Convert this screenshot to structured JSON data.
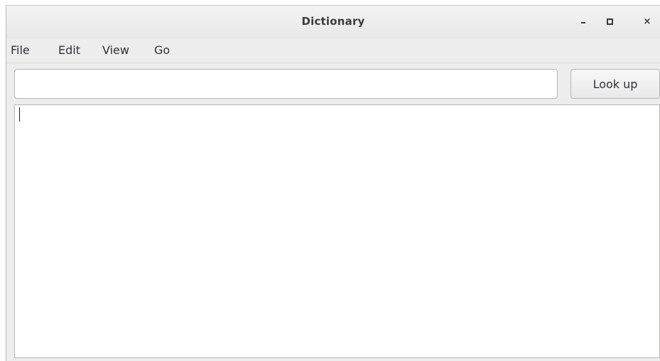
{
  "window": {
    "title": "Dictionary",
    "controls": {
      "minimize_icon": "minimize-icon",
      "maximize_icon": "maximize-icon",
      "close_icon": "close-icon",
      "close_glyph": "×"
    }
  },
  "menubar": {
    "items": [
      {
        "label": "File"
      },
      {
        "label": "Edit"
      },
      {
        "label": "View"
      },
      {
        "label": "Go"
      }
    ]
  },
  "search": {
    "value": "",
    "placeholder": ""
  },
  "lookup_button": {
    "label": "Look up"
  },
  "definition": {
    "text": ""
  },
  "colors": {
    "window_bg": "#ededed",
    "content_bg": "#ffffff",
    "border": "#b6b6b3",
    "text": "#2e3436",
    "title_text": "#3c3c3c"
  }
}
